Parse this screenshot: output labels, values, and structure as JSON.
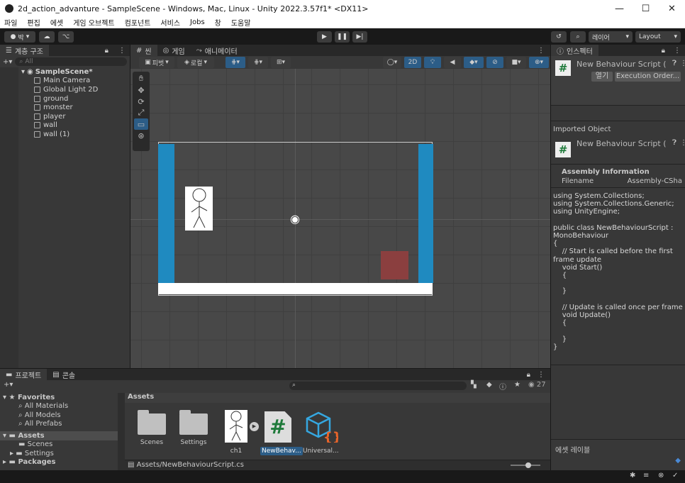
{
  "window": {
    "title": "2d_action_advanture - SampleScene - Windows, Mac, Linux - Unity 2022.3.57f1* <DX11>",
    "minimize": "—",
    "maximize": "☐",
    "close": "✕"
  },
  "menu": [
    "파일",
    "편집",
    "에셋",
    "게임 오브젝트",
    "컴포넌트",
    "서비스",
    "Jobs",
    "창",
    "도움말"
  ],
  "toolbar": {
    "account": "박",
    "layers": "레이어",
    "layout": "Layout"
  },
  "hierarchy": {
    "tab": "계층 구조",
    "search_placeholder": "All",
    "scene": "SampleScene*",
    "items": [
      "Main Camera",
      "Global Light 2D",
      "ground",
      "monster",
      "player",
      "wall",
      "wall (1)"
    ]
  },
  "scene_tabs": {
    "scene": "씬",
    "game": "게임",
    "animator": "애니메이터"
  },
  "scene_toolbar": {
    "pivot": "피벗",
    "local": "로컬",
    "mode_2d": "2D"
  },
  "inspector": {
    "tab": "인스펙터",
    "script_title": "New Behaviour Script (",
    "open": "열기",
    "execution_order": "Execution Order...",
    "imported_object": "Imported Object",
    "imported_title": "New Behaviour Script (",
    "assembly_info": "Assembly Information",
    "filename_label": "Filename",
    "filename_value": "Assembly-CSha",
    "code": "using System.Collections;\nusing System.Collections.Generic;\nusing UnityEngine;\n\npublic class NewBehaviourScript :\nMonoBehaviour\n{\n    // Start is called before the first\nframe update\n    void Start()\n    {\n\n    }\n\n    // Update is called once per frame\n    void Update()\n    {\n\n    }\n}",
    "asset_labels": "에셋 레이블"
  },
  "project": {
    "tab_project": "프로젝트",
    "tab_console": "콘솔",
    "hidden_count": "27",
    "favorites": "Favorites",
    "fav_items": [
      "All Materials",
      "All Models",
      "All Prefabs"
    ],
    "assets_root": "Assets",
    "asset_folders": [
      "Scenes",
      "Settings"
    ],
    "packages": "Packages",
    "breadcrumb": "Assets",
    "assets": [
      "Scenes",
      "Settings",
      "ch1",
      "NewBehav...",
      "Universal..."
    ],
    "selected_path": "Assets/NewBehaviourScript.cs"
  },
  "colors": {
    "accent": "#2c5d87",
    "wall": "#1f8ac0",
    "monster": "#8b3f3f",
    "selected": "#2c5d87"
  }
}
